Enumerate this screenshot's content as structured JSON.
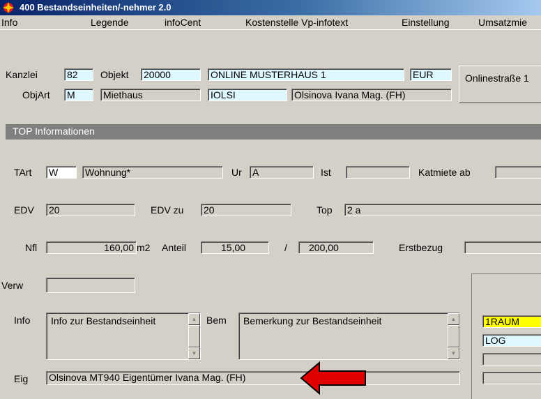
{
  "window": {
    "title": "400 Bestandseinheiten/-nehmer 2.0"
  },
  "menu": [
    "Info",
    "Legende",
    "infoCent",
    "Kostenstelle Vp-infotext",
    "Einstellung",
    "Umsatzmie"
  ],
  "header": {
    "kanzlei_label": "Kanzlei",
    "kanzlei_value": "82",
    "objekt_label": "Objekt",
    "objekt_value": "20000",
    "objekt_name": "ONLINE MUSTERHAUS 1",
    "currency": "EUR",
    "address_button": "Onlinestraße 1",
    "objart_label": "ObjArt",
    "objart_code": "M",
    "objart_name": "Miethaus",
    "owner_code": "IOLSI",
    "owner_name": "Olsinova Ivana Mag. (FH)"
  },
  "section": {
    "title": "TOP Informationen"
  },
  "top": {
    "tart_label": "TArt",
    "tart_code": "W",
    "tart_name": "Wohnung*",
    "ur_label": "Ur",
    "ur_value": "A",
    "ist_label": "Ist",
    "ist_value": "",
    "katmiete_label": "Katmiete ab",
    "katmiete_value": "",
    "edv_label": "EDV",
    "edv_value": "20",
    "edvzu_label": "EDV zu",
    "edvzu_value": "20",
    "top_label": "Top",
    "top_value": "2 a",
    "nfl_label": "Nfl",
    "nfl_value": "160,00",
    "nfl_unit": "m2",
    "anteil_label": "Anteil",
    "anteil_value": "15,00",
    "anteil_sep": "/",
    "anteil_total": "200,00",
    "erstbezug_label": "Erstbezug",
    "erstbezug_value": "",
    "verw_label": "Verw",
    "verw_value": "",
    "info_label": "Info",
    "info_text": "Info zur Bestandseinheit",
    "bem_label": "Bem",
    "bem_text": "Bemerkung zur Bestandseinheit",
    "eig_label": "Eig",
    "eig_value": "Olsinova MT940 Eigentümer Ivana Mag. (FH)"
  },
  "side_list": [
    "1RAUM",
    "LOG",
    "",
    ""
  ],
  "colors": {
    "highlight_yellow": "#ffff00",
    "field_cyan": "#dff8ff",
    "arrow_red": "#e00000"
  }
}
